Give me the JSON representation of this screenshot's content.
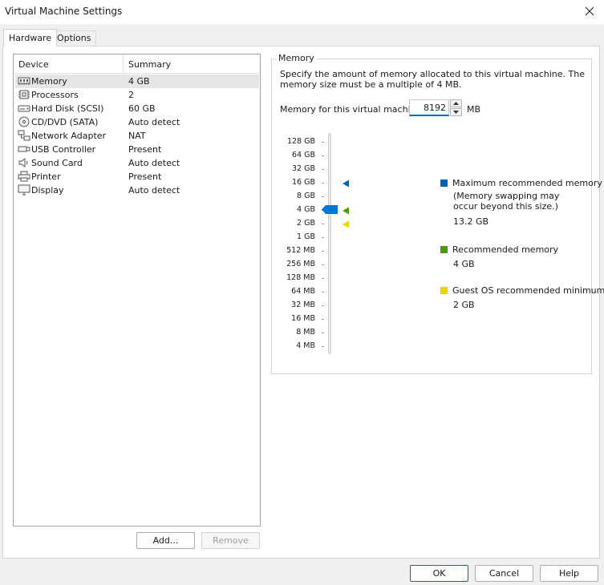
{
  "window": {
    "title": "Virtual Machine Settings"
  },
  "tabs": [
    {
      "label": "Hardware",
      "active": true
    },
    {
      "label": "Options",
      "active": false
    }
  ],
  "device_list": {
    "columns": [
      "Device",
      "Summary"
    ],
    "rows": [
      {
        "icon": "memory-icon",
        "device": "Memory",
        "summary": "4 GB",
        "selected": true
      },
      {
        "icon": "processor-icon",
        "device": "Processors",
        "summary": "2"
      },
      {
        "icon": "hard-disk-icon",
        "device": "Hard Disk (SCSI)",
        "summary": "60 GB"
      },
      {
        "icon": "cd-dvd-icon",
        "device": "CD/DVD (SATA)",
        "summary": "Auto detect"
      },
      {
        "icon": "network-adapter-icon",
        "device": "Network Adapter",
        "summary": "NAT"
      },
      {
        "icon": "usb-icon",
        "device": "USB Controller",
        "summary": "Present"
      },
      {
        "icon": "sound-icon",
        "device": "Sound Card",
        "summary": "Auto detect"
      },
      {
        "icon": "printer-icon",
        "device": "Printer",
        "summary": "Present"
      },
      {
        "icon": "display-icon",
        "device": "Display",
        "summary": "Auto detect"
      }
    ]
  },
  "list_buttons": {
    "add": "Add...",
    "remove": "Remove"
  },
  "memory": {
    "group_title": "Memory",
    "description": "Specify the amount of memory allocated to this virtual machine. The memory size must be a multiple of 4 MB.",
    "field_label": "Memory for this virtual machine:",
    "value": "8192",
    "unit": "MB",
    "scale_labels": [
      "128 GB",
      "64 GB",
      "32 GB",
      "16 GB",
      "8 GB",
      "4 GB",
      "2 GB",
      "1 GB",
      "512 MB",
      "256 MB",
      "128 MB",
      "64 MB",
      "32 MB",
      "16 MB",
      "8 MB",
      "4 MB"
    ],
    "slider_value": "4 GB",
    "markers": {
      "max_recommended": "16 GB",
      "recommended": "4 GB",
      "guest_min": "2 GB"
    },
    "legend": {
      "max": {
        "label": "Maximum recommended memory",
        "note_line1": "(Memory swapping may",
        "note_line2": "occur beyond this size.)",
        "value": "13.2 GB",
        "color": "#0063b1"
      },
      "recommended": {
        "label": "Recommended memory",
        "value": "4 GB",
        "color": "#4e9a06"
      },
      "guest_min": {
        "label": "Guest OS recommended minimum",
        "value": "2 GB",
        "color": "#f0d000"
      }
    }
  },
  "dialog_buttons": {
    "ok": "OK",
    "cancel": "Cancel",
    "help": "Help"
  },
  "colors": {
    "accent": "#0067c0",
    "thumb": "#0078d4"
  }
}
